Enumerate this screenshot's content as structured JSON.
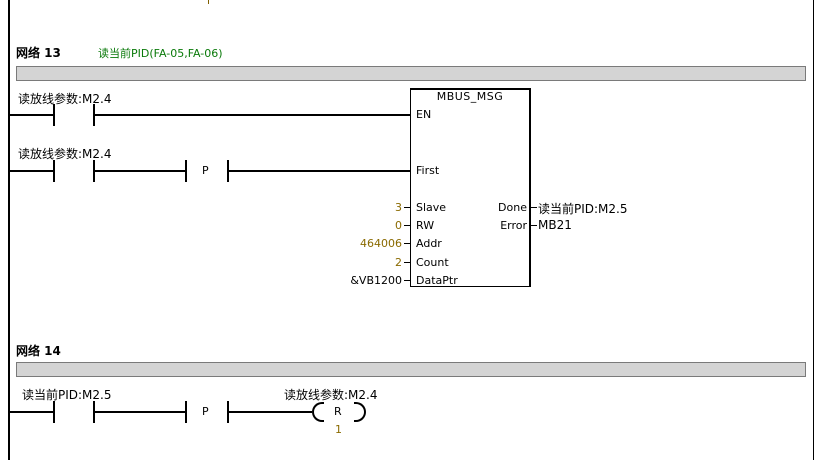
{
  "network13": {
    "title": "网络 13",
    "comment": "读当前PID(FA-05,FA-06)",
    "contact1_label": "读放线参数:M2.4",
    "contact2_label": "读放线参数:M2.4",
    "edge_label": "P",
    "block": {
      "name": "MBUS_MSG",
      "inputs": [
        "EN",
        "First",
        "Slave",
        "RW",
        "Addr",
        "Count",
        "DataPtr"
      ],
      "outputs": [
        "Done",
        "Error"
      ],
      "params": {
        "slave": "3",
        "rw": "0",
        "addr": "464006",
        "count": "2",
        "dataptr": "&VB1200"
      },
      "done_target": "读当前PID:M2.5",
      "error_target": "MB21"
    }
  },
  "network14": {
    "title": "网络 14",
    "contact_label": "读当前PID:M2.5",
    "edge_label": "P",
    "coil_label": "读放线参数:M2.4",
    "coil_type": "R",
    "coil_count": "1"
  }
}
